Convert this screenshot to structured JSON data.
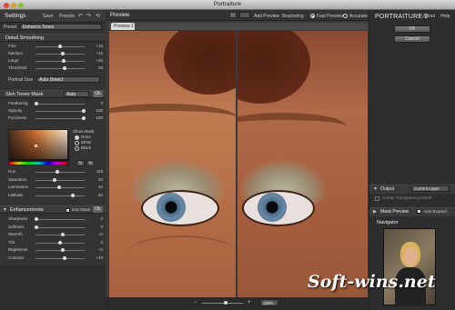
{
  "window": {
    "title": "Portraiture"
  },
  "left": {
    "title": "Settings",
    "save": "Save",
    "presets": "Presets",
    "preset_label": "Preset",
    "preset_value": "Enhance Tones",
    "detail_smoothing": {
      "header": "Detail Smoothing",
      "sliders": [
        {
          "label": "Fine",
          "value": "+10",
          "pos": 0.5
        },
        {
          "label": "Medium",
          "value": "+16",
          "pos": 0.55
        },
        {
          "label": "Large",
          "value": "+20",
          "pos": 0.58
        },
        {
          "label": "Threshold",
          "value": "28",
          "pos": 0.6
        }
      ],
      "portrait_size_label": "Portrait Size",
      "portrait_size_value": "Auto Detect"
    },
    "skin_mask": {
      "header": "Skin Tones Mask",
      "mode": "Auto",
      "ok": "Ok",
      "sliders": [
        {
          "label": "Feathering",
          "value": "0",
          "pos": 0.02
        },
        {
          "label": "Opacity",
          "value": "100",
          "pos": 0.98
        },
        {
          "label": "Fuzziness",
          "value": "100",
          "pos": 0.98
        }
      ],
      "show_mask_label": "Show Mask:",
      "show_mask_options": [
        "None",
        "White",
        "Black"
      ],
      "sliders2": [
        {
          "label": "Hue",
          "value": "119",
          "pos": 0.45
        },
        {
          "label": "Saturation",
          "value": "33",
          "pos": 0.38
        },
        {
          "label": "Luminance",
          "value": "45",
          "pos": 0.48
        },
        {
          "label": "Latitude",
          "value": "82",
          "pos": 0.75
        }
      ]
    },
    "enhancements": {
      "header": "Enhancements",
      "use_mask": "Use Mask",
      "ok": "Ok",
      "sliders": [
        {
          "label": "Sharpness",
          "value": "0",
          "pos": 0.02
        },
        {
          "label": "Softness",
          "value": "0",
          "pos": 0.02
        },
        {
          "label": "Warmth",
          "value": "+4",
          "pos": 0.55
        },
        {
          "label": "Tint",
          "value": "0",
          "pos": 0.5
        },
        {
          "label": "Brightness",
          "value": "+4",
          "pos": 0.55
        },
        {
          "label": "Contrast",
          "value": "+10",
          "pos": 0.6
        }
      ]
    }
  },
  "center": {
    "title": "Preview",
    "add_preview": "Add Preview",
    "bracketing": "Bracketing",
    "fast_preview": "Fast Preview",
    "accurate": "Accurate",
    "tab": "Preview 1",
    "zoom": "100%"
  },
  "right": {
    "title_a": "PORTRAIT",
    "title_b": "URE 2",
    "about": "About",
    "help": "Help",
    "ok": "OK",
    "cancel": "Cancel",
    "output_label": "Output",
    "output_value": "Current Layer",
    "create_transparency": "Create Transparency Mask",
    "mask_preview": "Mask Preview",
    "auto_expand": "Auto Expand",
    "navigator": "Navigator",
    "watermark": "Soft-wins.net"
  },
  "colors": {
    "accent": "#e07a20"
  }
}
